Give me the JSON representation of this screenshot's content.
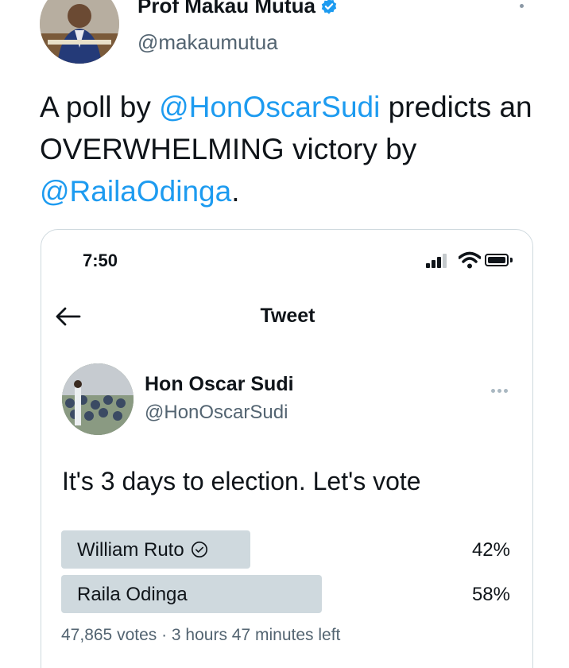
{
  "outer_tweet": {
    "author_name": "Prof Makau Mutua",
    "author_handle": "@makaumutua",
    "text_parts": {
      "p1": "A poll by ",
      "mention1": "@HonOscarSudi",
      "p2": " predicts an OVERWHELMING victory by ",
      "mention2": "@RailaOdinga",
      "p3": "."
    },
    "verified": true,
    "icons": {
      "verified": "verified-badge-icon",
      "more": "more-vertical-icon"
    }
  },
  "embedded_screenshot": {
    "status_bar": {
      "time": "7:50",
      "icons": [
        "signal-icon",
        "wifi-icon",
        "battery-icon"
      ]
    },
    "nav": {
      "title": "Tweet",
      "back_icon": "arrow-left-icon"
    },
    "tweet": {
      "author_name": "Hon Oscar Sudi",
      "author_handle": "@HonOscarSudi",
      "text": "It's 3 days to election. Let's vote",
      "more_icon": "more-horizontal-icon"
    },
    "poll": {
      "options": [
        {
          "label": "William Ruto",
          "percent_text": "42%",
          "fraction": 0.42,
          "selected": true
        },
        {
          "label": "Raila Odinga",
          "percent_text": "58%",
          "fraction": 0.58,
          "selected": false
        }
      ],
      "meta": "47,865 votes · 3 hours 47 minutes left"
    }
  },
  "colors": {
    "text": "#0f1419",
    "secondary": "#536471",
    "accent": "#1d9bf0",
    "poll_bar": "#cfd9de",
    "border": "#cfd9de"
  }
}
